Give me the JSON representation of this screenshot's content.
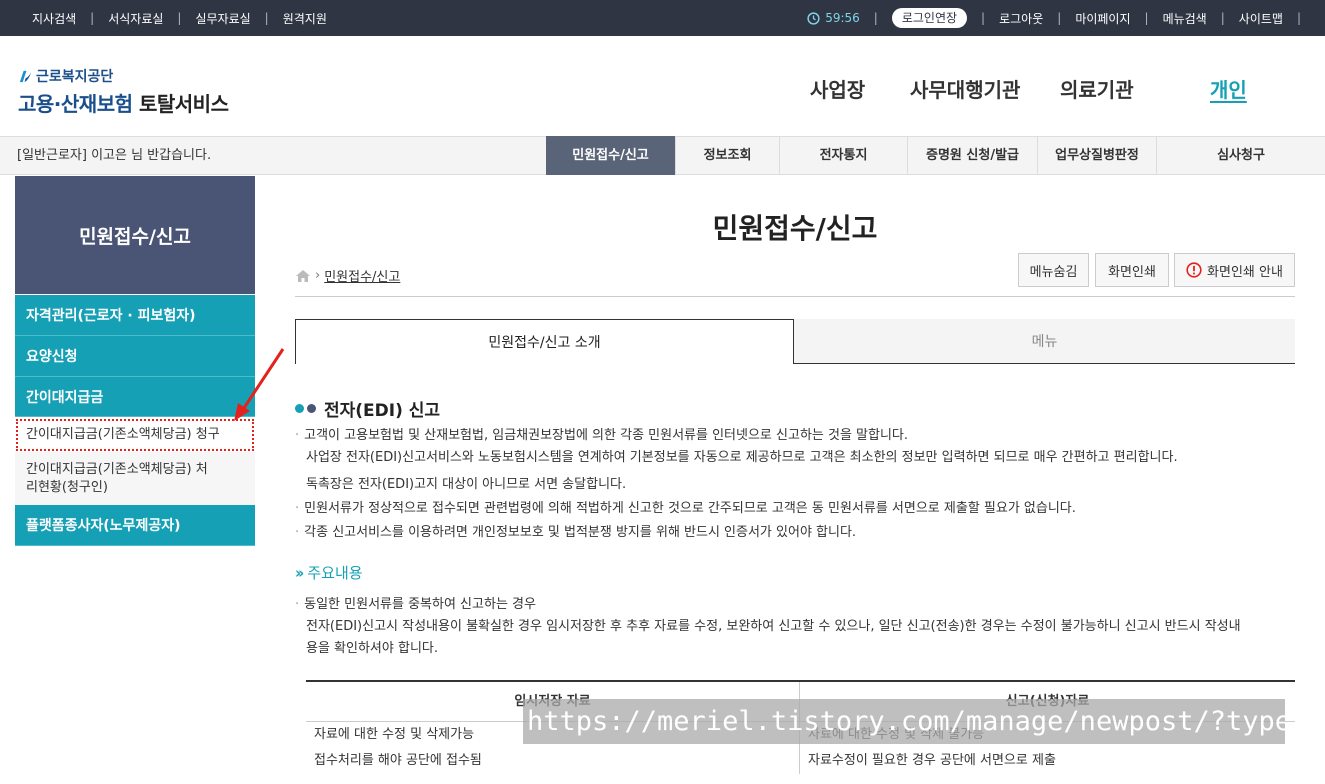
{
  "topbar": {
    "links": [
      "지사검색",
      "서식자료실",
      "실무자료실",
      "원격지원"
    ],
    "timer": "59:56",
    "extend_label": "로그인연장",
    "right_links": [
      "로그아웃",
      "마이페이지",
      "메뉴검색",
      "사이트맵"
    ]
  },
  "logo": {
    "org": "근로복지공단",
    "service_a": "고용·산재보험",
    "service_b": "토탈서비스"
  },
  "gnb": [
    "사업장",
    "사무대행기관",
    "의료기관",
    "개인"
  ],
  "subbar": {
    "welcome": "[일반근로자] 이고은 님 반갑습니다.",
    "tabs": [
      "민원접수/신고",
      "정보조회",
      "전자통지",
      "증명원 신청/발급",
      "업무상질병판정",
      "심사청구"
    ]
  },
  "sidebar": {
    "title": "민원접수/신고",
    "items": [
      "자격관리(근로자 · 피보험자)",
      "요양신청",
      "간이대지급금",
      "간이대지급금(기존소액체당금) 청구",
      "간이대지급금(기존소액체당금) 처리현황(청구인)",
      "플랫폼종사자(노무제공자)"
    ]
  },
  "main": {
    "title": "민원접수/신고",
    "breadcrumb": "민원접수/신고",
    "buttons": [
      "메뉴숨김",
      "화면인쇄",
      "화면인쇄 안내"
    ],
    "tabs": [
      "민원접수/신고 소개",
      "메뉴"
    ],
    "section_title": "전자(EDI) 신고",
    "paras": [
      "고객이 고용보험법 및 산재보험법, 임금채권보장법에 의한 각종 민원서류를 인터넷으로 신고하는 것을 말합니다.",
      "사업장 전자(EDI)신고서비스와 노동보험시스템을 연계하여 기본정보를 자동으로 제공하므로 고객은 최소한의 정보만 입력하면 되므로 매우 간편하고 편리합니다.",
      "독촉장은 전자(EDI)고지 대상이 아니므로 서면 송달합니다.",
      "민원서류가 정상적으로 접수되면 관련법령에 의해 적법하게 신고한 것으로 간주되므로 고객은 동 민원서류를 서면으로 제출할 필요가 없습니다.",
      "각종 신고서비스를 이용하려면 개인정보보호 및 법적분쟁 방지를 위해 반드시 인증서가 있어야 합니다."
    ],
    "sub_title": "주요내용",
    "sub_paras": [
      "동일한 민원서류를 중복하여 신고하는 경우",
      "전자(EDI)신고시 작성내용이 불확실한 경우 임시저장한 후 추후 자료를 수정, 보완하여 신고할 수 있으나, 일단 신고(전송)한 경우는 수정이 불가능하니 신고시 반드시 작성내",
      "용을 확인하셔야 합니다."
    ],
    "table": {
      "headers": [
        "임시저장 자료",
        "신고(신청)자료"
      ],
      "rows": [
        [
          "자료에 대한 수정 및 삭제가능",
          "자료에 대한 수정 및 삭제 불가능"
        ],
        [
          "접수처리를 해야 공단에 접수됨",
          "자료수정이 필요한 경우 공단에 서면으로 제출"
        ]
      ]
    }
  },
  "watermark": "https://meriel.tistory.com/manage/newpost/?type=po",
  "colors": {
    "teal": "#16a0b5",
    "navy": "#4a5474",
    "topbar": "#2f3543",
    "highlight": "#e4211c"
  }
}
